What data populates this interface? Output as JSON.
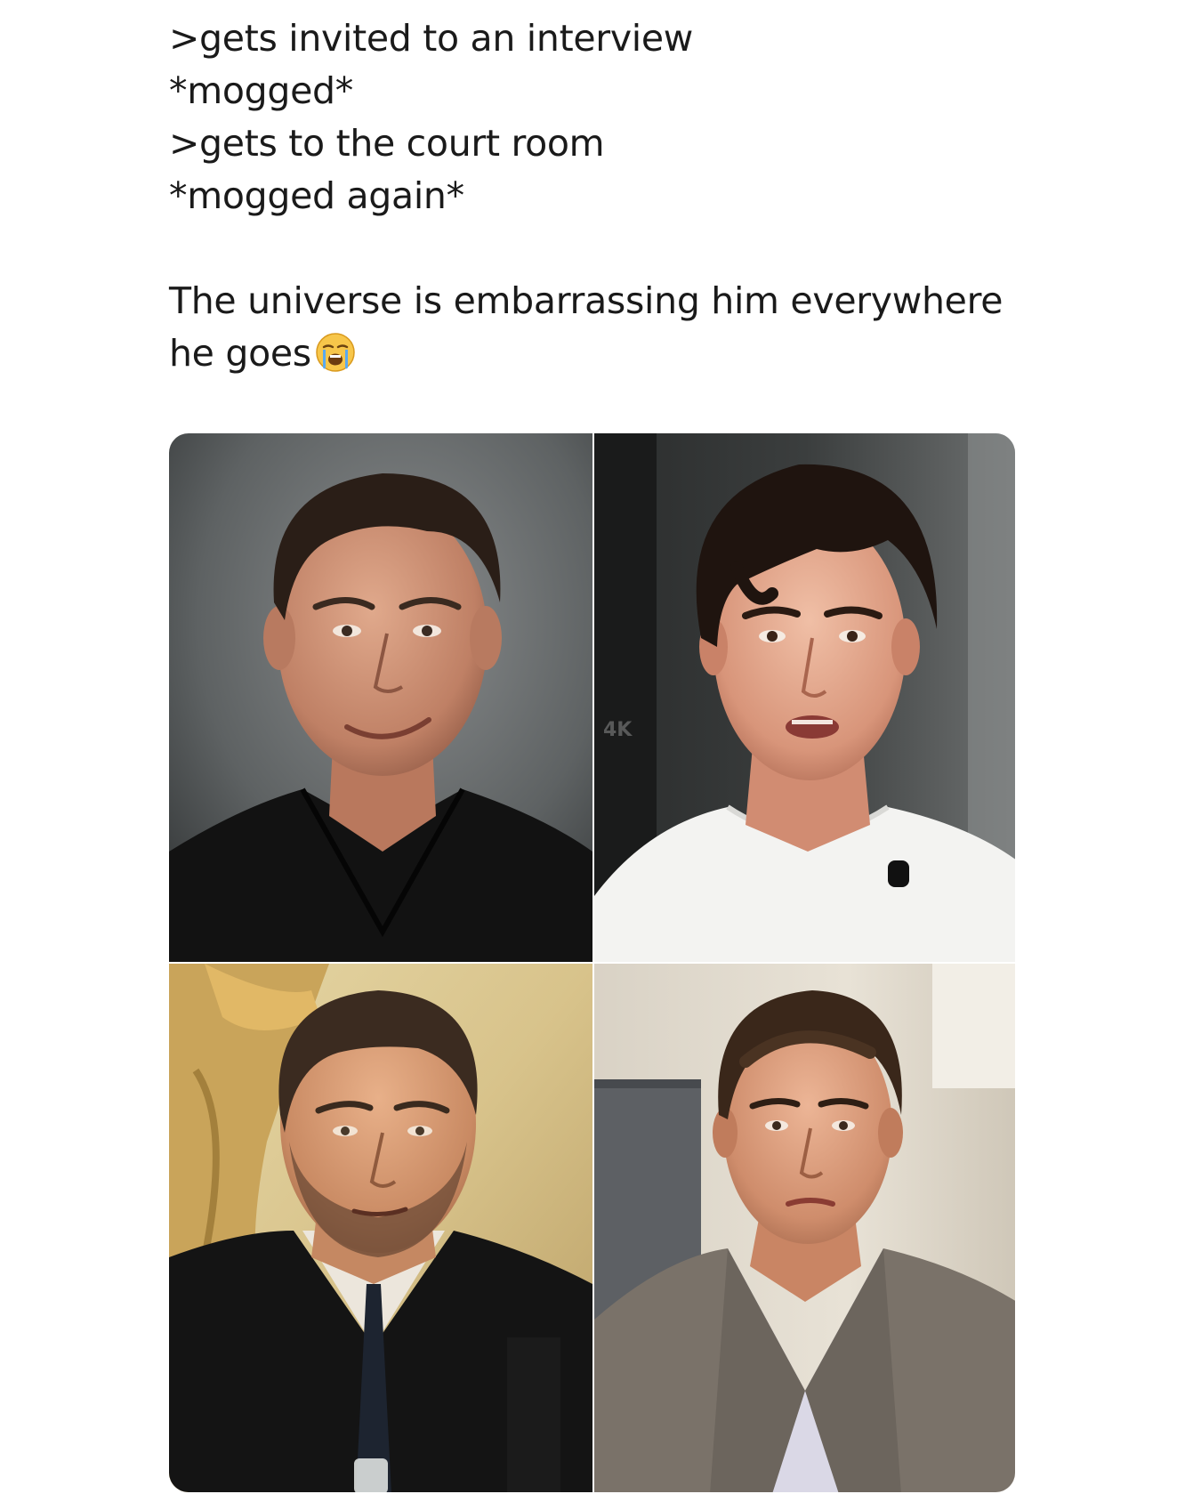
{
  "post": {
    "lines": [
      ">gets invited to an interview",
      "*mogged*",
      ">gets to the court room",
      "*mogged again*"
    ],
    "caption": "The universe is embarrassing him everywhere he goes",
    "caption_emoji": "loudly-crying-face-icon"
  },
  "photos": {
    "watermark": "4K",
    "panels": [
      {
        "subject": "older man in black shirt, interview setting"
      },
      {
        "subject": "young man in white t-shirt with lapel mic, interview setting"
      },
      {
        "subject": "judge in black robe, courtroom"
      },
      {
        "subject": "young man in gray suit, courtroom"
      }
    ]
  }
}
